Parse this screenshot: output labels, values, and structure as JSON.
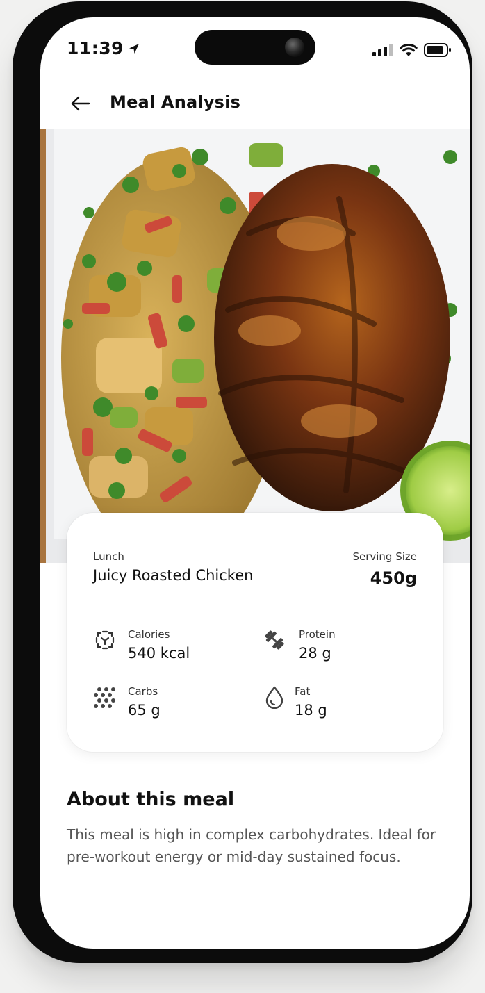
{
  "status_bar": {
    "time": "11:39"
  },
  "header": {
    "title": "Meal Analysis"
  },
  "meal": {
    "type": "Lunch",
    "name": "Juicy Roasted Chicken",
    "serving_label": "Serving Size",
    "serving_value": "450g"
  },
  "stats": [
    {
      "label": "Calories",
      "value": "540 kcal",
      "icon": "calories-icon"
    },
    {
      "label": "Protein",
      "value": "28 g",
      "icon": "dumbbell-icon"
    },
    {
      "label": "Carbs",
      "value": "65 g",
      "icon": "grain-dots-icon"
    },
    {
      "label": "Fat",
      "value": "18 g",
      "icon": "droplet-icon"
    }
  ],
  "about": {
    "title": "About this meal",
    "text": "This meal is high in complex carbohydrates. Ideal for pre-workout energy or mid-day sustained focus."
  },
  "colors": {
    "text": "#111111",
    "muted": "#555555",
    "background": "#ffffff",
    "frame": "#0c0c0c"
  }
}
